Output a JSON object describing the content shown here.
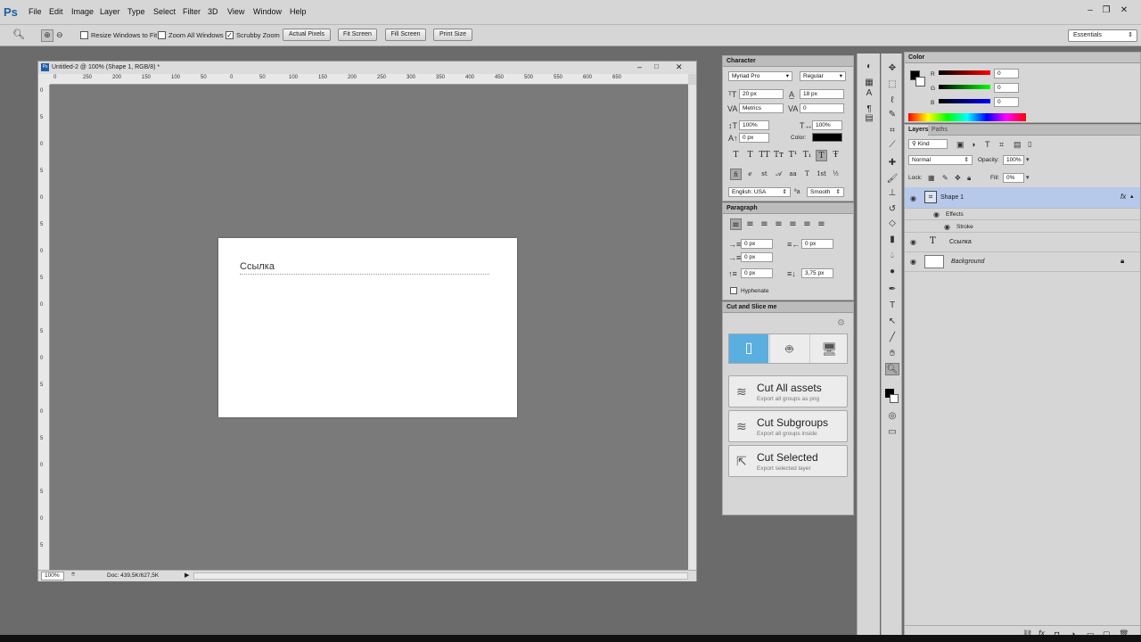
{
  "app": {
    "logo": "Ps"
  },
  "menu": [
    "File",
    "Edit",
    "Image",
    "Layer",
    "Type",
    "Select",
    "Filter",
    "3D",
    "View",
    "Window",
    "Help"
  ],
  "options": {
    "resize_windows": "Resize Windows to Fit",
    "zoom_all_windows": "Zoom All Windows",
    "scrubby_zoom": "Scrubby Zoom",
    "actual_pixels": "Actual Pixels",
    "fit_screen": "Fit Screen",
    "fill_screen": "Fill Screen",
    "print_size": "Print Size",
    "workspace": "Essentials"
  },
  "document": {
    "title": "Untitled-2 @ 100% (Shape 1, RGB/8) *",
    "ruler_h": [
      "0",
      "250",
      "200",
      "150",
      "100",
      "50",
      "0",
      "50",
      "100",
      "150",
      "200",
      "250",
      "300",
      "350",
      "400",
      "450",
      "500",
      "550",
      "600",
      "650"
    ],
    "ruler_v": [
      "0",
      "5",
      "0",
      "5",
      "0",
      "5",
      "0",
      "5",
      "0",
      "5",
      "0",
      "5",
      "0",
      "5",
      "0",
      "5",
      "0",
      "5"
    ],
    "canvas_text": "Ссылка",
    "zoom": "100%",
    "doc_size": "Doc: 439,5K/627,5K"
  },
  "character": {
    "title": "Character",
    "font_family": "Myriad Pro",
    "font_style": "Regular",
    "font_size": "20 px",
    "leading": "18 px",
    "kerning": "Metrics",
    "tracking": "0",
    "vscale": "100%",
    "hscale": "100%",
    "baseline": "0 px",
    "color_label": "Color:",
    "language": "English: USA",
    "antialias": "Smooth",
    "type_buttons": [
      "T",
      "T",
      "TT",
      "Tт",
      "T¹",
      "T₁",
      "T",
      "Ŧ"
    ],
    "ot_buttons": [
      "fi",
      "ℯ",
      "st",
      "𝒜",
      "aa",
      "T",
      "1st",
      "½"
    ]
  },
  "paragraph": {
    "title": "Paragraph",
    "indent_left": "0 px",
    "indent_right": "0 px",
    "indent_first": "0 px",
    "space_before": "0 px",
    "space_after": "3,75 px",
    "hyphenate": "Hyphenate"
  },
  "cutslice": {
    "title": "Cut and Slice me",
    "buttons": [
      {
        "title": "Cut All assets",
        "sub": "Export all groups as png"
      },
      {
        "title": "Cut Subgroups",
        "sub": "Export all groups inside"
      },
      {
        "title": "Cut Selected",
        "sub": "Export selected layer"
      }
    ]
  },
  "color": {
    "title": "Color",
    "r_label": "R",
    "g_label": "G",
    "b_label": "B",
    "r": "0",
    "g": "0",
    "b": "0"
  },
  "layers": {
    "tab_layers": "Layers",
    "tab_paths": "Paths",
    "kind": "Kind",
    "blend": "Normal",
    "opacity_label": "Opacity:",
    "opacity": "100%",
    "lock_label": "Lock:",
    "fill_label": "Fill:",
    "fill": "0%",
    "items": [
      {
        "name": "Shape 1",
        "fx": "fx"
      },
      {
        "name": "Effects"
      },
      {
        "name": "Stroke"
      },
      {
        "name": "Ссылка"
      },
      {
        "name": "Background"
      }
    ]
  },
  "colors": {
    "selection": "#b7c9ea",
    "accent_blue": "#5aaee0"
  }
}
